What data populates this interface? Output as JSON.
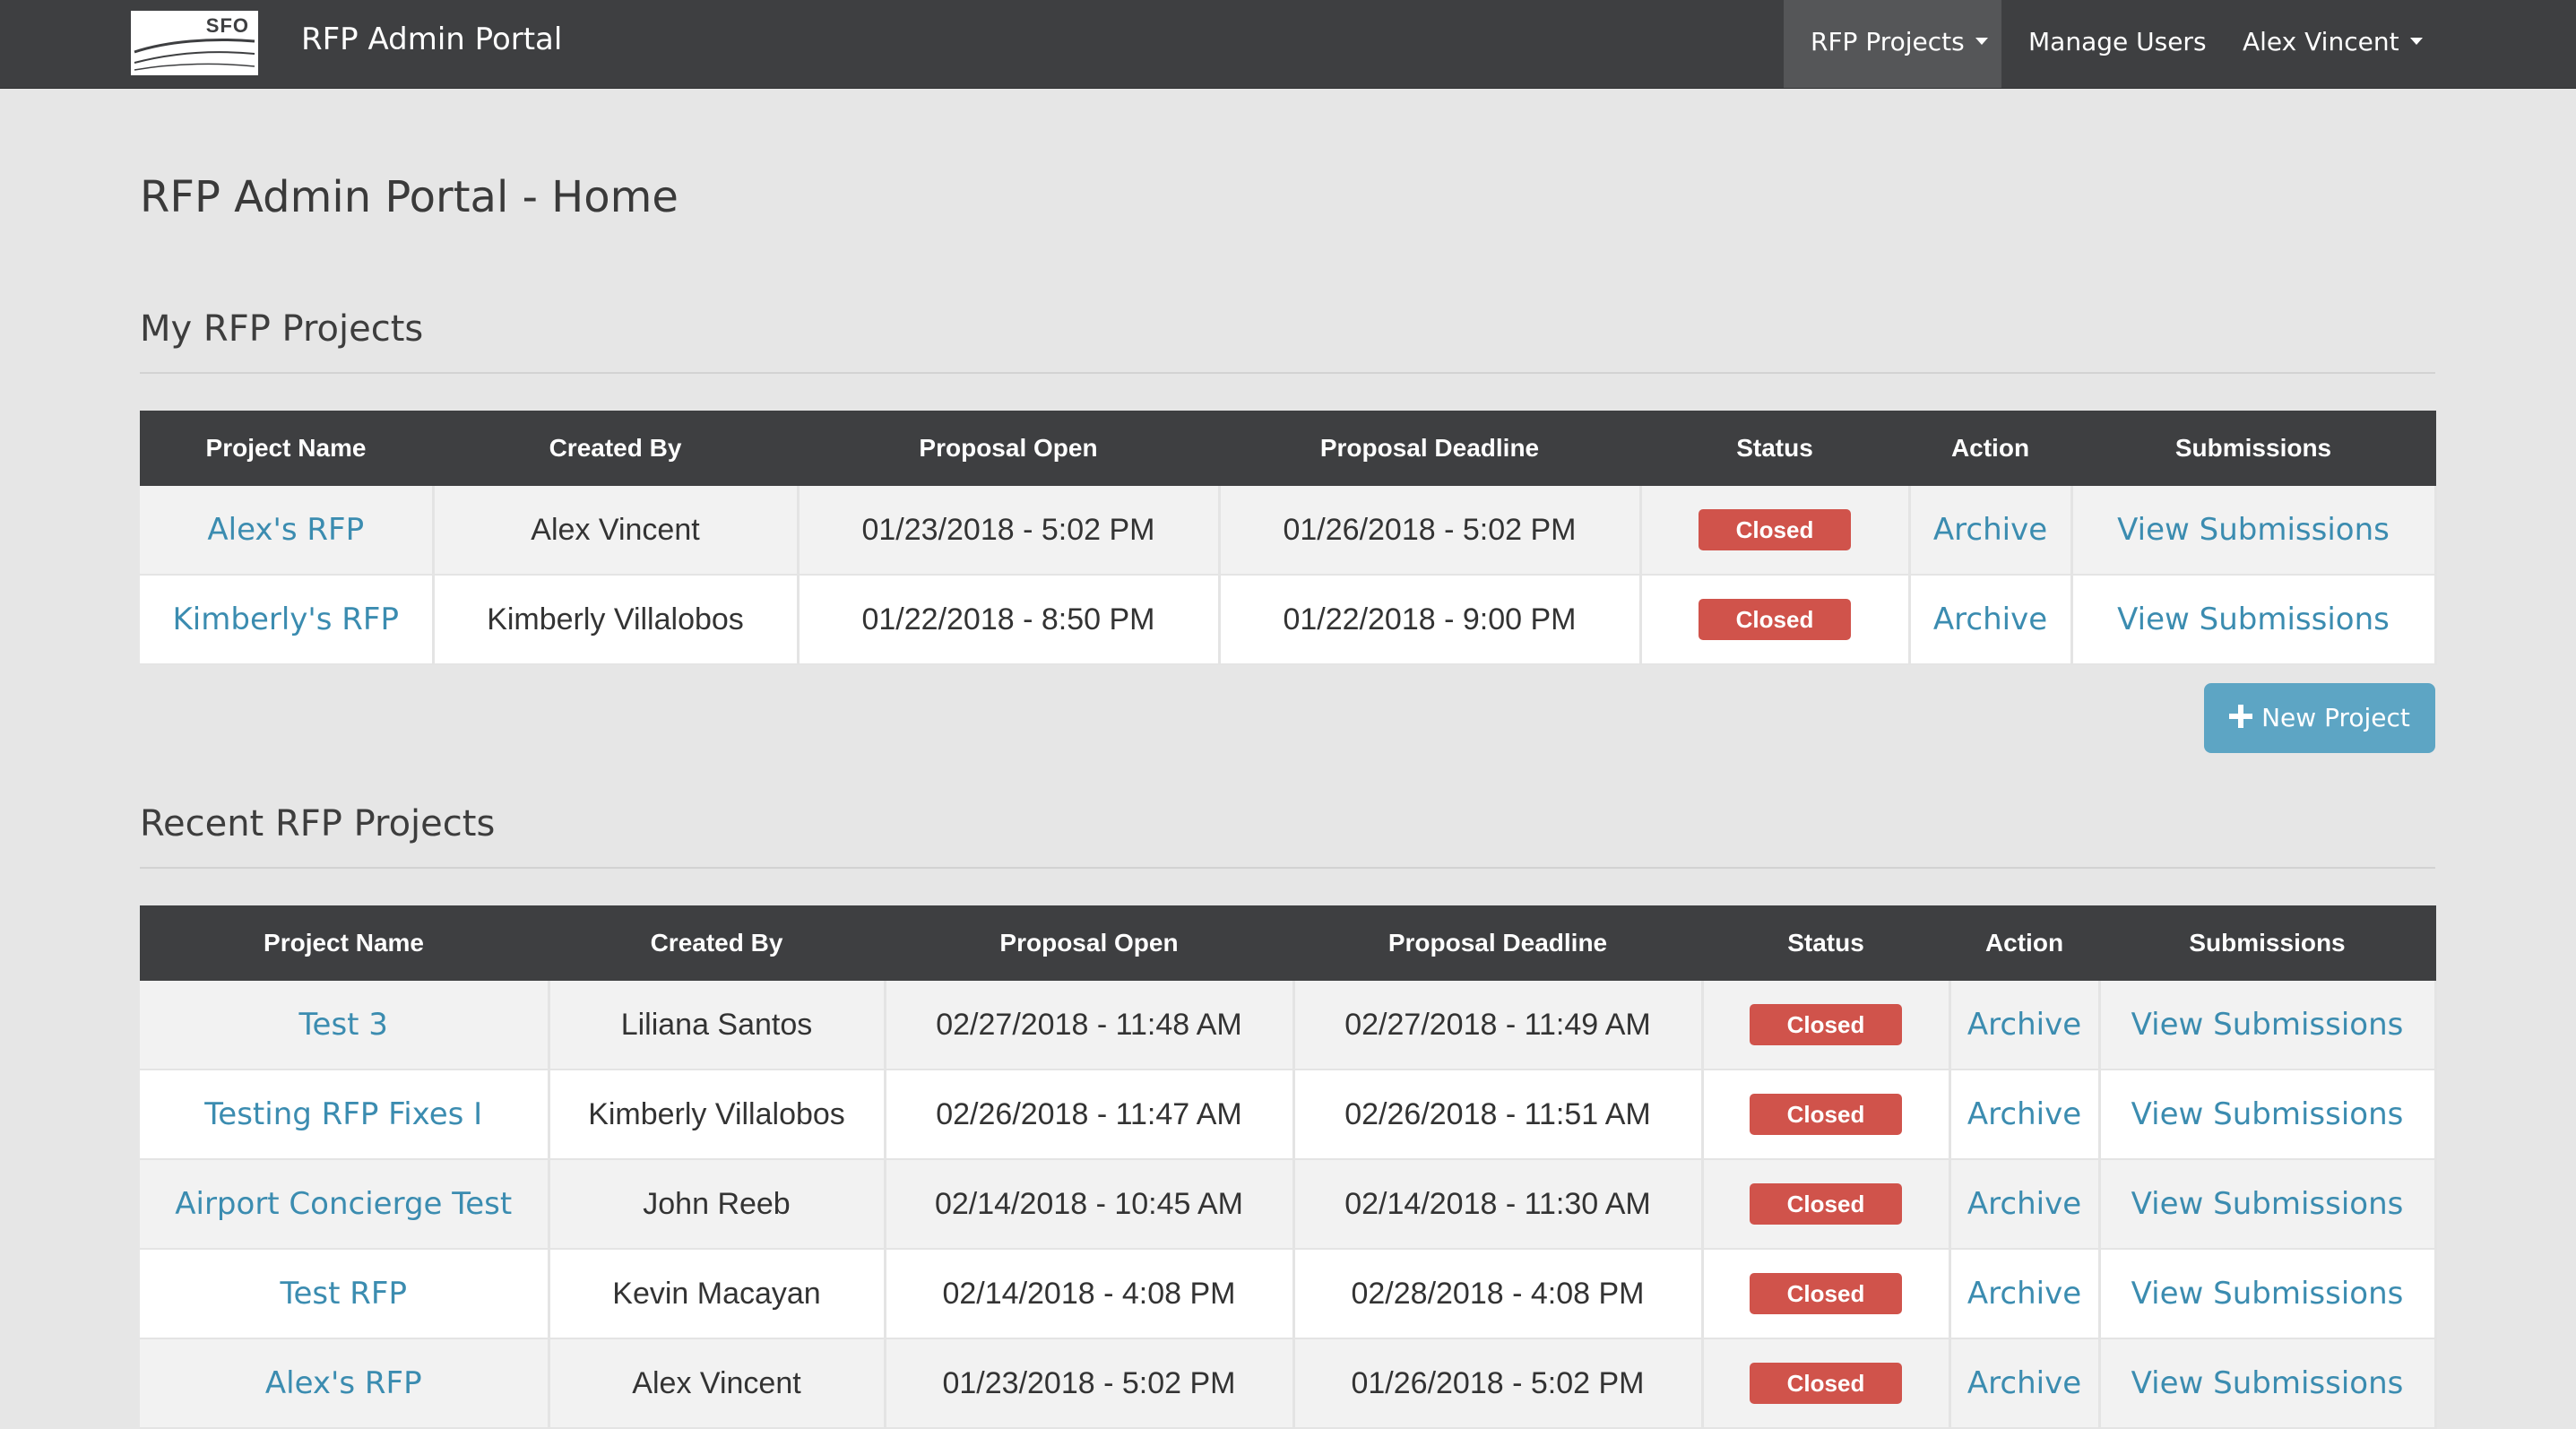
{
  "navbar": {
    "logo_text": "SFO",
    "title": "RFP Admin Portal",
    "menu": [
      {
        "label": "RFP Projects",
        "active": true,
        "dropdown": true
      },
      {
        "label": "Manage Users",
        "active": false,
        "dropdown": false
      },
      {
        "label": "Alex Vincent",
        "active": false,
        "dropdown": true
      }
    ]
  },
  "page": {
    "title": "RFP Admin Portal - Home"
  },
  "columns": [
    "Project Name",
    "Created By",
    "Proposal Open",
    "Proposal Deadline",
    "Status",
    "Action",
    "Submissions"
  ],
  "my_projects": {
    "heading": "My RFP Projects",
    "rows": [
      {
        "name": "Alex's RFP",
        "created_by": "Alex Vincent",
        "open": "01/23/2018 - 5:02 PM",
        "deadline": "01/26/2018 - 5:02 PM",
        "status": "Closed",
        "action": "Archive",
        "submissions": "View Submissions"
      },
      {
        "name": "Kimberly's RFP",
        "created_by": "Kimberly Villalobos",
        "open": "01/22/2018 - 8:50 PM",
        "deadline": "01/22/2018 - 9:00 PM",
        "status": "Closed",
        "action": "Archive",
        "submissions": "View Submissions"
      }
    ],
    "new_project_label": "New Project"
  },
  "recent_projects": {
    "heading": "Recent RFP Projects",
    "rows": [
      {
        "name": "Test 3",
        "created_by": "Liliana Santos",
        "open": "02/27/2018 - 11:48 AM",
        "deadline": "02/27/2018 - 11:49 AM",
        "status": "Closed",
        "action": "Archive",
        "submissions": "View Submissions"
      },
      {
        "name": "Testing RFP Fixes I",
        "created_by": "Kimberly Villalobos",
        "open": "02/26/2018 - 11:47 AM",
        "deadline": "02/26/2018 - 11:51 AM",
        "status": "Closed",
        "action": "Archive",
        "submissions": "View Submissions"
      },
      {
        "name": "Airport Concierge Test",
        "created_by": "John Reeb",
        "open": "02/14/2018 - 10:45 AM",
        "deadline": "02/14/2018 - 11:30 AM",
        "status": "Closed",
        "action": "Archive",
        "submissions": "View Submissions"
      },
      {
        "name": "Test RFP",
        "created_by": "Kevin Macayan",
        "open": "02/14/2018 - 4:08 PM",
        "deadline": "02/28/2018 - 4:08 PM",
        "status": "Closed",
        "action": "Archive",
        "submissions": "View Submissions"
      },
      {
        "name": "Alex's RFP",
        "created_by": "Alex Vincent",
        "open": "01/23/2018 - 5:02 PM",
        "deadline": "01/26/2018 - 5:02 PM",
        "status": "Closed",
        "action": "Archive",
        "submissions": "View Submissions"
      }
    ]
  },
  "colors": {
    "navbar_bg": "#3e3f41",
    "page_bg": "#e6e6e6",
    "link": "#3b8cb0",
    "status_closed": "#d0534b",
    "primary_button": "#5da5c4"
  }
}
